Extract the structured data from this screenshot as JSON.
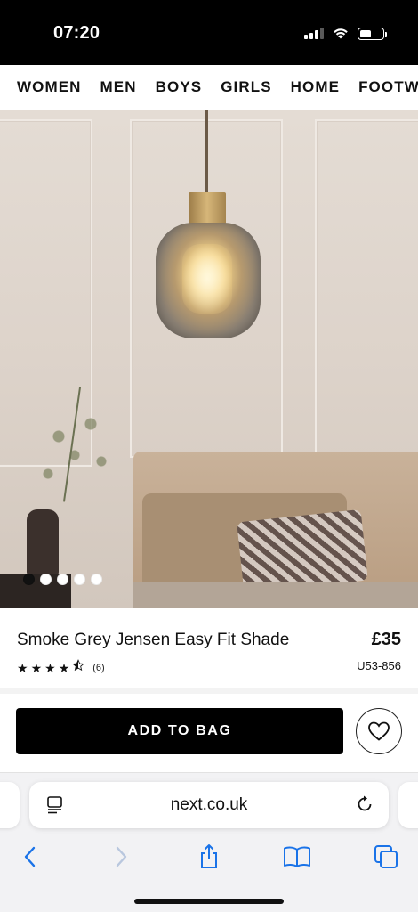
{
  "status_bar": {
    "time": "07:20"
  },
  "nav": {
    "categories": [
      "WOMEN",
      "MEN",
      "BOYS",
      "GIRLS",
      "HOME",
      "FOOTWEAR"
    ]
  },
  "carousel": {
    "total": 5,
    "active_index": 0
  },
  "product": {
    "title": "Smoke Grey Jensen Easy Fit Shade",
    "price": "£35",
    "rating_stars": 4.5,
    "rating_count": "(6)",
    "code": "U53-856"
  },
  "actions": {
    "add_to_bag_label": "ADD TO BAG"
  },
  "browser": {
    "url": "next.co.uk"
  },
  "icons": {
    "wishlist": "heart-icon",
    "reader": "reader-mode-icon",
    "reload": "reload-icon",
    "back": "chevron-left-icon",
    "forward": "chevron-right-icon",
    "share": "share-icon",
    "bookmarks": "book-icon",
    "tabs": "tabs-icon"
  },
  "colors": {
    "accent": "#1a73e8",
    "button": "#000000"
  }
}
